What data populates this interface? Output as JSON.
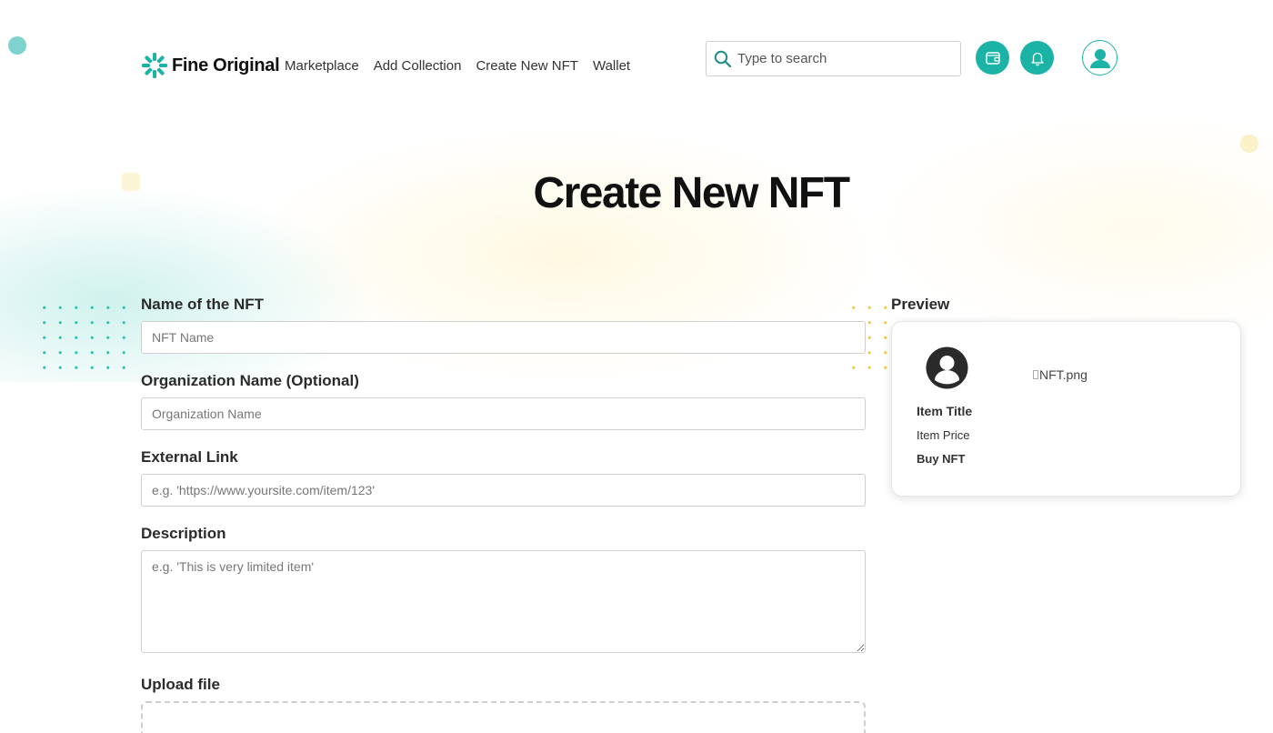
{
  "brand": {
    "name": "Fine Original",
    "accent": "#1bb3a6"
  },
  "nav": {
    "items": [
      {
        "label": "Marketplace"
      },
      {
        "label": "Add Collection"
      },
      {
        "label": "Create New NFT"
      },
      {
        "label": "Wallet"
      }
    ]
  },
  "search": {
    "placeholder": "Type to search",
    "icon": "search-icon"
  },
  "header_actions": {
    "wallet_icon": "wallet-icon",
    "bell_icon": "bell-icon",
    "avatar_icon": "user-icon"
  },
  "page": {
    "title": "Create New NFT"
  },
  "form": {
    "name": {
      "label": "Name of the NFT",
      "placeholder": "NFT Name",
      "value": ""
    },
    "organization": {
      "label": "Organization Name (Optional)",
      "placeholder": "Organization Name",
      "value": ""
    },
    "external_link": {
      "label": "External Link",
      "placeholder": "e.g. 'https://www.yoursite.com/item/123'",
      "value": ""
    },
    "description": {
      "label": "Description",
      "placeholder": "e.g. 'This is very limited item'",
      "value": ""
    },
    "upload": {
      "label": "Upload file"
    }
  },
  "preview": {
    "label": "Preview",
    "item_title": "Item Title",
    "item_price": "Item Price",
    "buy_label": "Buy NFT",
    "image_alt": "NFT.png"
  }
}
